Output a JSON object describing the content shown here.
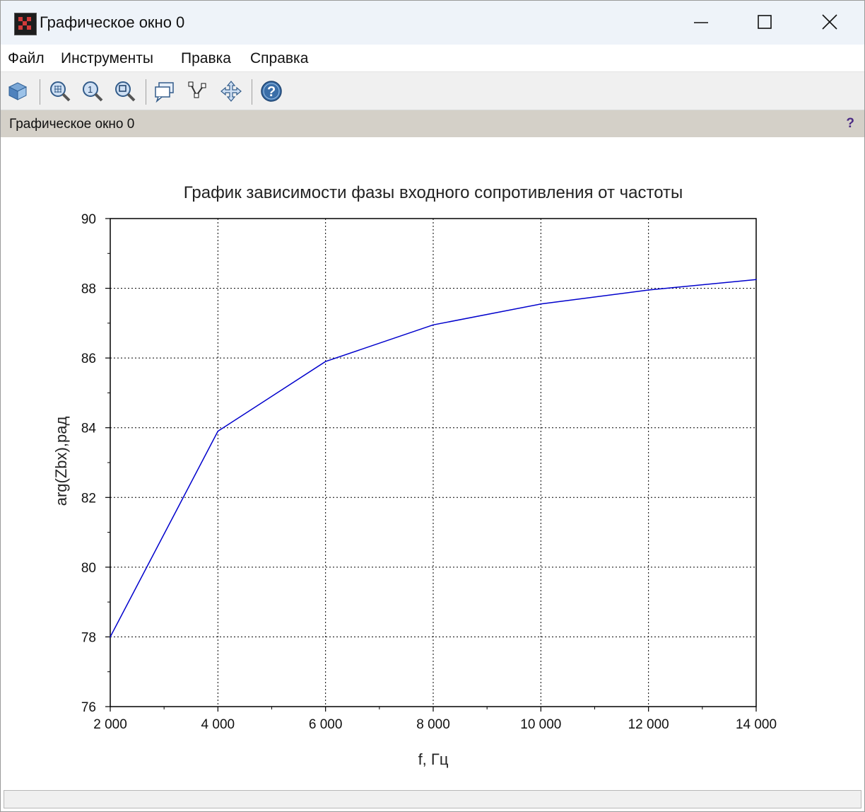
{
  "window": {
    "title": "Графическое окно 0"
  },
  "menu": {
    "items": [
      "Файл",
      "Инструменты",
      "Правка",
      "Справка"
    ]
  },
  "toolbar": {
    "icons": [
      "rotate-icon",
      "zoom-grid-icon",
      "zoom-original-icon",
      "zoom-area-icon",
      "datatip-icon",
      "datatip-edit-icon",
      "pan-icon",
      "help-icon"
    ]
  },
  "infobar": {
    "title": "Графическое окно 0",
    "help": "?"
  },
  "colors": {
    "line": "#0000cc",
    "grid": "#000000",
    "infobar_bg": "#d4d0c8"
  },
  "chart_data": {
    "type": "line",
    "title": "График зависимости фазы входного сопротивления от частоты",
    "xlabel": "f, Гц",
    "ylabel": "arg(Zbx),рад",
    "xlim": [
      2000,
      14000
    ],
    "ylim": [
      76,
      90
    ],
    "x_ticks": [
      "2 000",
      "4 000",
      "6 000",
      "8 000",
      "10 000",
      "12 000",
      "14 000"
    ],
    "y_ticks": [
      "76",
      "78",
      "80",
      "82",
      "84",
      "86",
      "88",
      "90"
    ],
    "grid": true,
    "series": [
      {
        "x": [
          2000,
          4000,
          6000,
          8000,
          10000,
          12000,
          14000
        ],
        "values": [
          78.0,
          83.9,
          85.9,
          86.95,
          87.55,
          87.95,
          88.25
        ]
      }
    ]
  }
}
